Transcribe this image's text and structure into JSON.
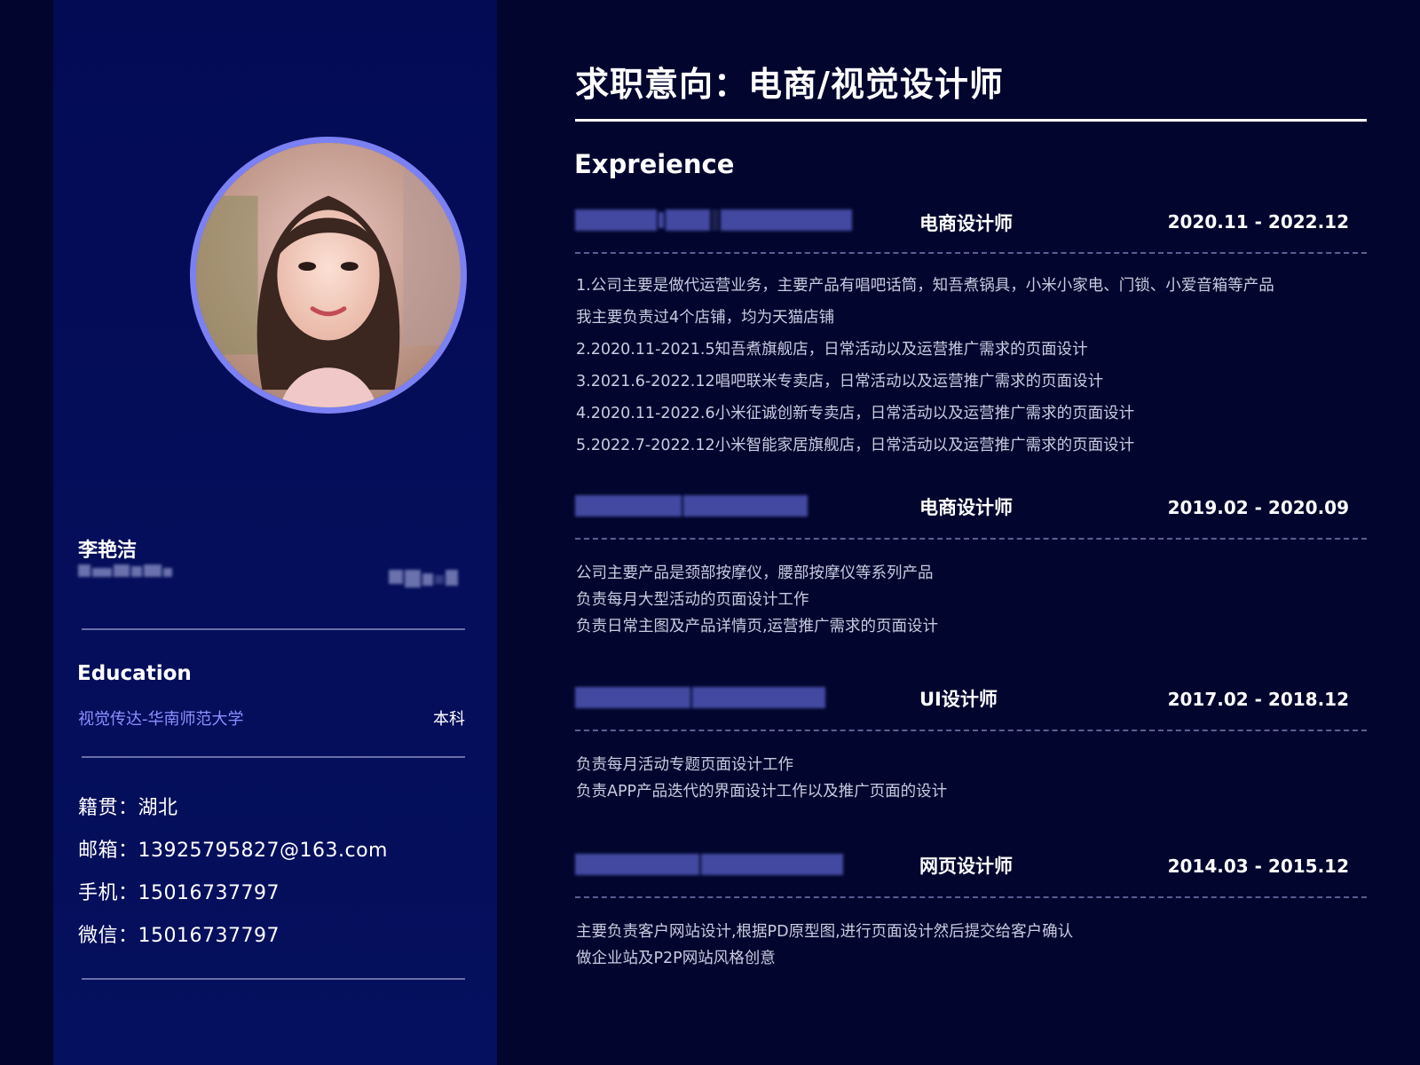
{
  "profile": {
    "name": "李艳洁",
    "education_heading": "Education",
    "education": {
      "school": "视觉传达-华南师范大学",
      "degree": "本科"
    },
    "contacts": [
      {
        "label": "籍贯：",
        "value": "湖北"
      },
      {
        "label": "邮箱：",
        "value": "13925795827@163.com"
      },
      {
        "label": "手机：",
        "value": "15016737797"
      },
      {
        "label": "微信：",
        "value": "15016737797"
      }
    ]
  },
  "main": {
    "title": "求职意向：电商/视觉设计师",
    "experience_heading": "Expreience",
    "jobs": [
      {
        "role": "电商设计师",
        "date": "2020.11 - 2022.12",
        "lines": [
          "1.公司主要是做代运营业务，主要产品有唱吧话筒，知吾煮锅具，小米小家电、门锁、小爱音箱等产品",
          "我主要负责过4个店铺，均为天猫店铺",
          "2.2020.11-2021.5知吾煮旗舰店，日常活动以及运营推广需求的页面设计",
          "3.2021.6-2022.12唱吧联米专卖店，日常活动以及运营推广需求的页面设计",
          "4.2020.11-2022.6小米征诚创新专卖店，日常活动以及运营推广需求的页面设计",
          "5.2022.7-2022.12小米智能家居旗舰店，日常活动以及运营推广需求的页面设计"
        ]
      },
      {
        "role": "电商设计师",
        "date": "2019.02 - 2020.09",
        "lines": [
          "公司主要产品是颈部按摩仪，腰部按摩仪等系列产品",
          "负责每月大型活动的页面设计工作",
          "负责日常主图及产品详情页,运营推广需求的页面设计"
        ]
      },
      {
        "role": "UI设计师",
        "date": "2017.02 - 2018.12",
        "lines": [
          "负责每月活动专题页面设计工作",
          "负责APP产品迭代的界面设计工作以及推广页面的设计"
        ]
      },
      {
        "role": "网页设计师",
        "date": "2014.03 - 2015.12",
        "lines": [
          "主要负责客户网站设计,根据PD原型图,进行页面设计然后提交给客户确认",
          "做企业站及P2P网站风格创意"
        ]
      }
    ]
  },
  "colors": {
    "background": "#02062e",
    "sidebar": "#040d5a",
    "accent": "#8c90ff",
    "avatar_ring": "#7b81f2"
  }
}
